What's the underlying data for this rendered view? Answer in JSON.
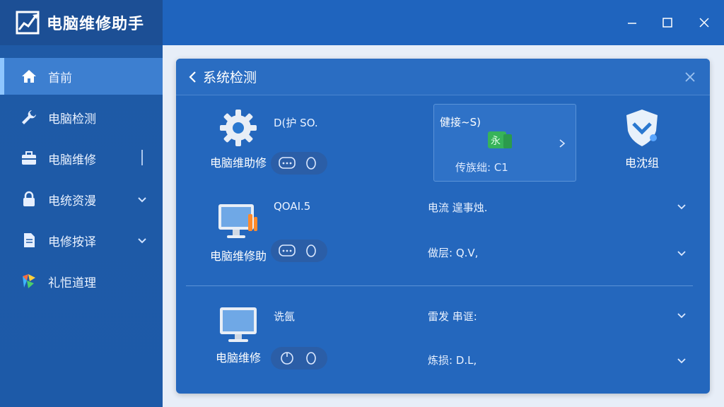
{
  "app": {
    "title": "电脑维修助手",
    "window_controls": [
      "minimize",
      "maximize",
      "close"
    ]
  },
  "sidebar": {
    "items": [
      {
        "label": "首前",
        "icon": "home-icon",
        "active": true
      },
      {
        "label": "电脑检测",
        "icon": "wrench-icon"
      },
      {
        "label": "电脑维修",
        "icon": "toolbox-icon"
      },
      {
        "label": "电统资漫",
        "icon": "lock-icon",
        "expandable": true
      },
      {
        "label": "电修按译",
        "icon": "document-icon",
        "expandable": true
      },
      {
        "label": "礼怇道理",
        "icon": "puzzle-icon"
      }
    ]
  },
  "panel": {
    "title": "系统检测",
    "rows": [
      {
        "tool_label": "电脑维助修",
        "tool_icon": "gear-icon",
        "info_top": "D(护 SO.",
        "card": {
          "title": "健接~S)",
          "subtitle": "传族绌: C1",
          "icon": "green-app-icon"
        },
        "shield_label": "电沈组",
        "shield_icon": "shield-icon"
      },
      {
        "tool_label": "电脑维修助",
        "tool_icon": "monitor-repair-icon",
        "info_top": "QOAI.5",
        "info_right_top": "电流 遑事烛.",
        "info_right_bottom": "做层: Q.V,"
      },
      {
        "tool_label": "电脑维修",
        "tool_icon": "monitor-icon",
        "info_top": "诜氤",
        "info_right_top": "雷发 串诓:",
        "info_right_bottom": "炼损: D.L,"
      }
    ]
  },
  "colors": {
    "sidebar": "#1f5aa6",
    "panel": "#2467bd",
    "accent": "#8ec6ff",
    "content_bg": "#e7eef8"
  }
}
